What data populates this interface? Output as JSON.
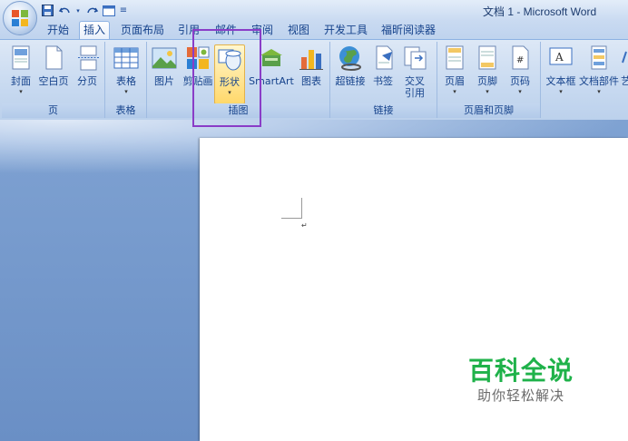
{
  "window": {
    "title": "文档 1 - Microsoft Word"
  },
  "qat": {
    "save_icon": "save-icon",
    "undo_icon": "undo-icon",
    "redo_icon": "redo-icon",
    "customize_icon": "dropdown-icon"
  },
  "tabs": [
    {
      "label": "开始",
      "active": false
    },
    {
      "label": "插入",
      "active": true
    },
    {
      "label": "页面布局",
      "active": false
    },
    {
      "label": "引用",
      "active": false
    },
    {
      "label": "邮件",
      "active": false
    },
    {
      "label": "审阅",
      "active": false
    },
    {
      "label": "视图",
      "active": false
    },
    {
      "label": "开发工具",
      "active": false
    },
    {
      "label": "福昕阅读器",
      "active": false
    }
  ],
  "ribbon": {
    "groups": {
      "pages": "页",
      "tables": "表格",
      "illustrations": "插图",
      "links": "链接",
      "header_footer": "页眉和页脚"
    },
    "buttons": {
      "cover": "封面",
      "blank_page": "空白页",
      "page_break": "分页",
      "table": "表格",
      "picture": "图片",
      "clip_art": "剪贴画",
      "shapes": "形状",
      "smartart": "SmartArt",
      "chart": "图表",
      "hyperlink": "超链接",
      "bookmark": "书签",
      "cross_ref_1": "交叉",
      "cross_ref_2": "引用",
      "header": "页眉",
      "footer": "页脚",
      "page_number": "页码",
      "textbox": "文本框",
      "quick_parts": "文档部件",
      "wordart": "艺"
    }
  },
  "watermark": {
    "title": "百科全说",
    "subtitle": "助你轻松解决"
  },
  "colors": {
    "accent_purple": "#8a3dc7",
    "watermark_green": "#1fb24a",
    "ribbon_text": "#15428b"
  }
}
